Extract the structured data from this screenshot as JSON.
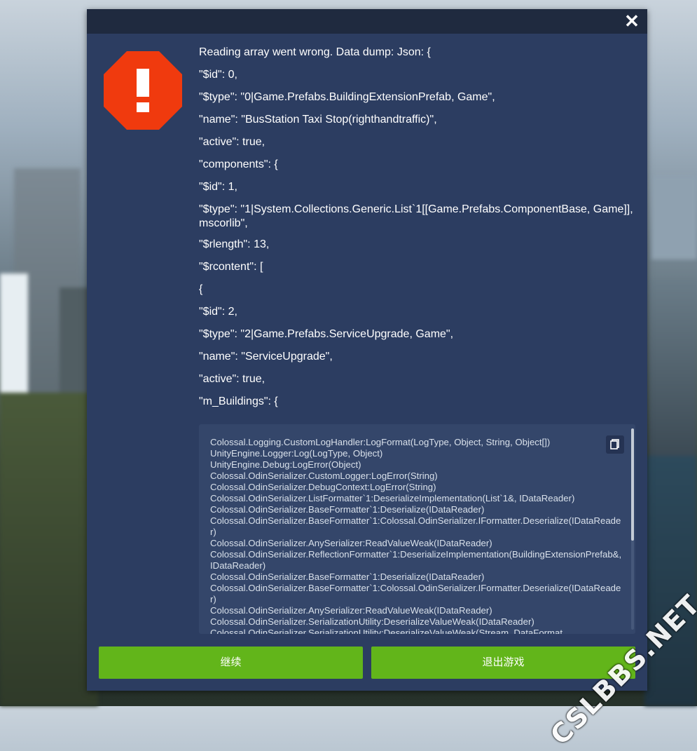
{
  "dialog": {
    "close_label": "✕",
    "message_lines": [
      "Reading array went wrong. Data dump: Json: {",
      "\"$id\": 0,",
      "\"$type\": \"0|Game.Prefabs.BuildingExtensionPrefab, Game\",",
      "\"name\": \"BusStation Taxi Stop(righthandtraffic)\",",
      "\"active\": true,",
      "\"components\": {",
      "\"$id\": 1,",
      "\"$type\": \"1|System.Collections.Generic.List`1[[Game.Prefabs.ComponentBase, Game]], mscorlib\",",
      "\"$rlength\": 13,",
      "\"$rcontent\": [",
      "{",
      "\"$id\": 2,",
      "\"$type\": \"2|Game.Prefabs.ServiceUpgrade, Game\",",
      "\"name\": \"ServiceUpgrade\",",
      "\"active\": true,",
      "\"m_Buildings\": {"
    ],
    "stack_trace": "Colossal.Logging.CustomLogHandler:LogFormat(LogType, Object, String, Object[])\nUnityEngine.Logger:Log(LogType, Object)\nUnityEngine.Debug:LogError(Object)\nColossal.OdinSerializer.CustomLogger:LogError(String)\nColossal.OdinSerializer.DebugContext:LogError(String)\nColossal.OdinSerializer.ListFormatter`1:DeserializeImplementation(List`1&, IDataReader)\nColossal.OdinSerializer.BaseFormatter`1:Deserialize(IDataReader)\nColossal.OdinSerializer.BaseFormatter`1:Colossal.OdinSerializer.IFormatter.Deserialize(IDataReader)\nColossal.OdinSerializer.AnySerializer:ReadValueWeak(IDataReader)\nColossal.OdinSerializer.ReflectionFormatter`1:DeserializeImplementation(BuildingExtensionPrefab&, IDataReader)\nColossal.OdinSerializer.BaseFormatter`1:Deserialize(IDataReader)\nColossal.OdinSerializer.BaseFormatter`1:Colossal.OdinSerializer.IFormatter.Deserialize(IDataReader)\nColossal.OdinSerializer.AnySerializer:ReadValueWeak(IDataReader)\nColossal.OdinSerializer.SerializationUtility:DeserializeValueWeak(IDataReader)\nColossal.OdinSerializer.SerializationUtility:DeserializeValueWeak(Stream, DataFormat,",
    "buttons": {
      "continue_label": "继续",
      "exit_label": "退出游戏"
    }
  },
  "watermark": "CSLBBS.NET",
  "colors": {
    "dialog_bg": "#2c3d61",
    "titlebar_bg": "#1f2a3f",
    "button_green": "#62b51a",
    "alert_red": "#f03a0e"
  },
  "icons": {
    "alert": "alert-octagon-icon",
    "close": "close-icon",
    "copy": "copy-icon"
  }
}
